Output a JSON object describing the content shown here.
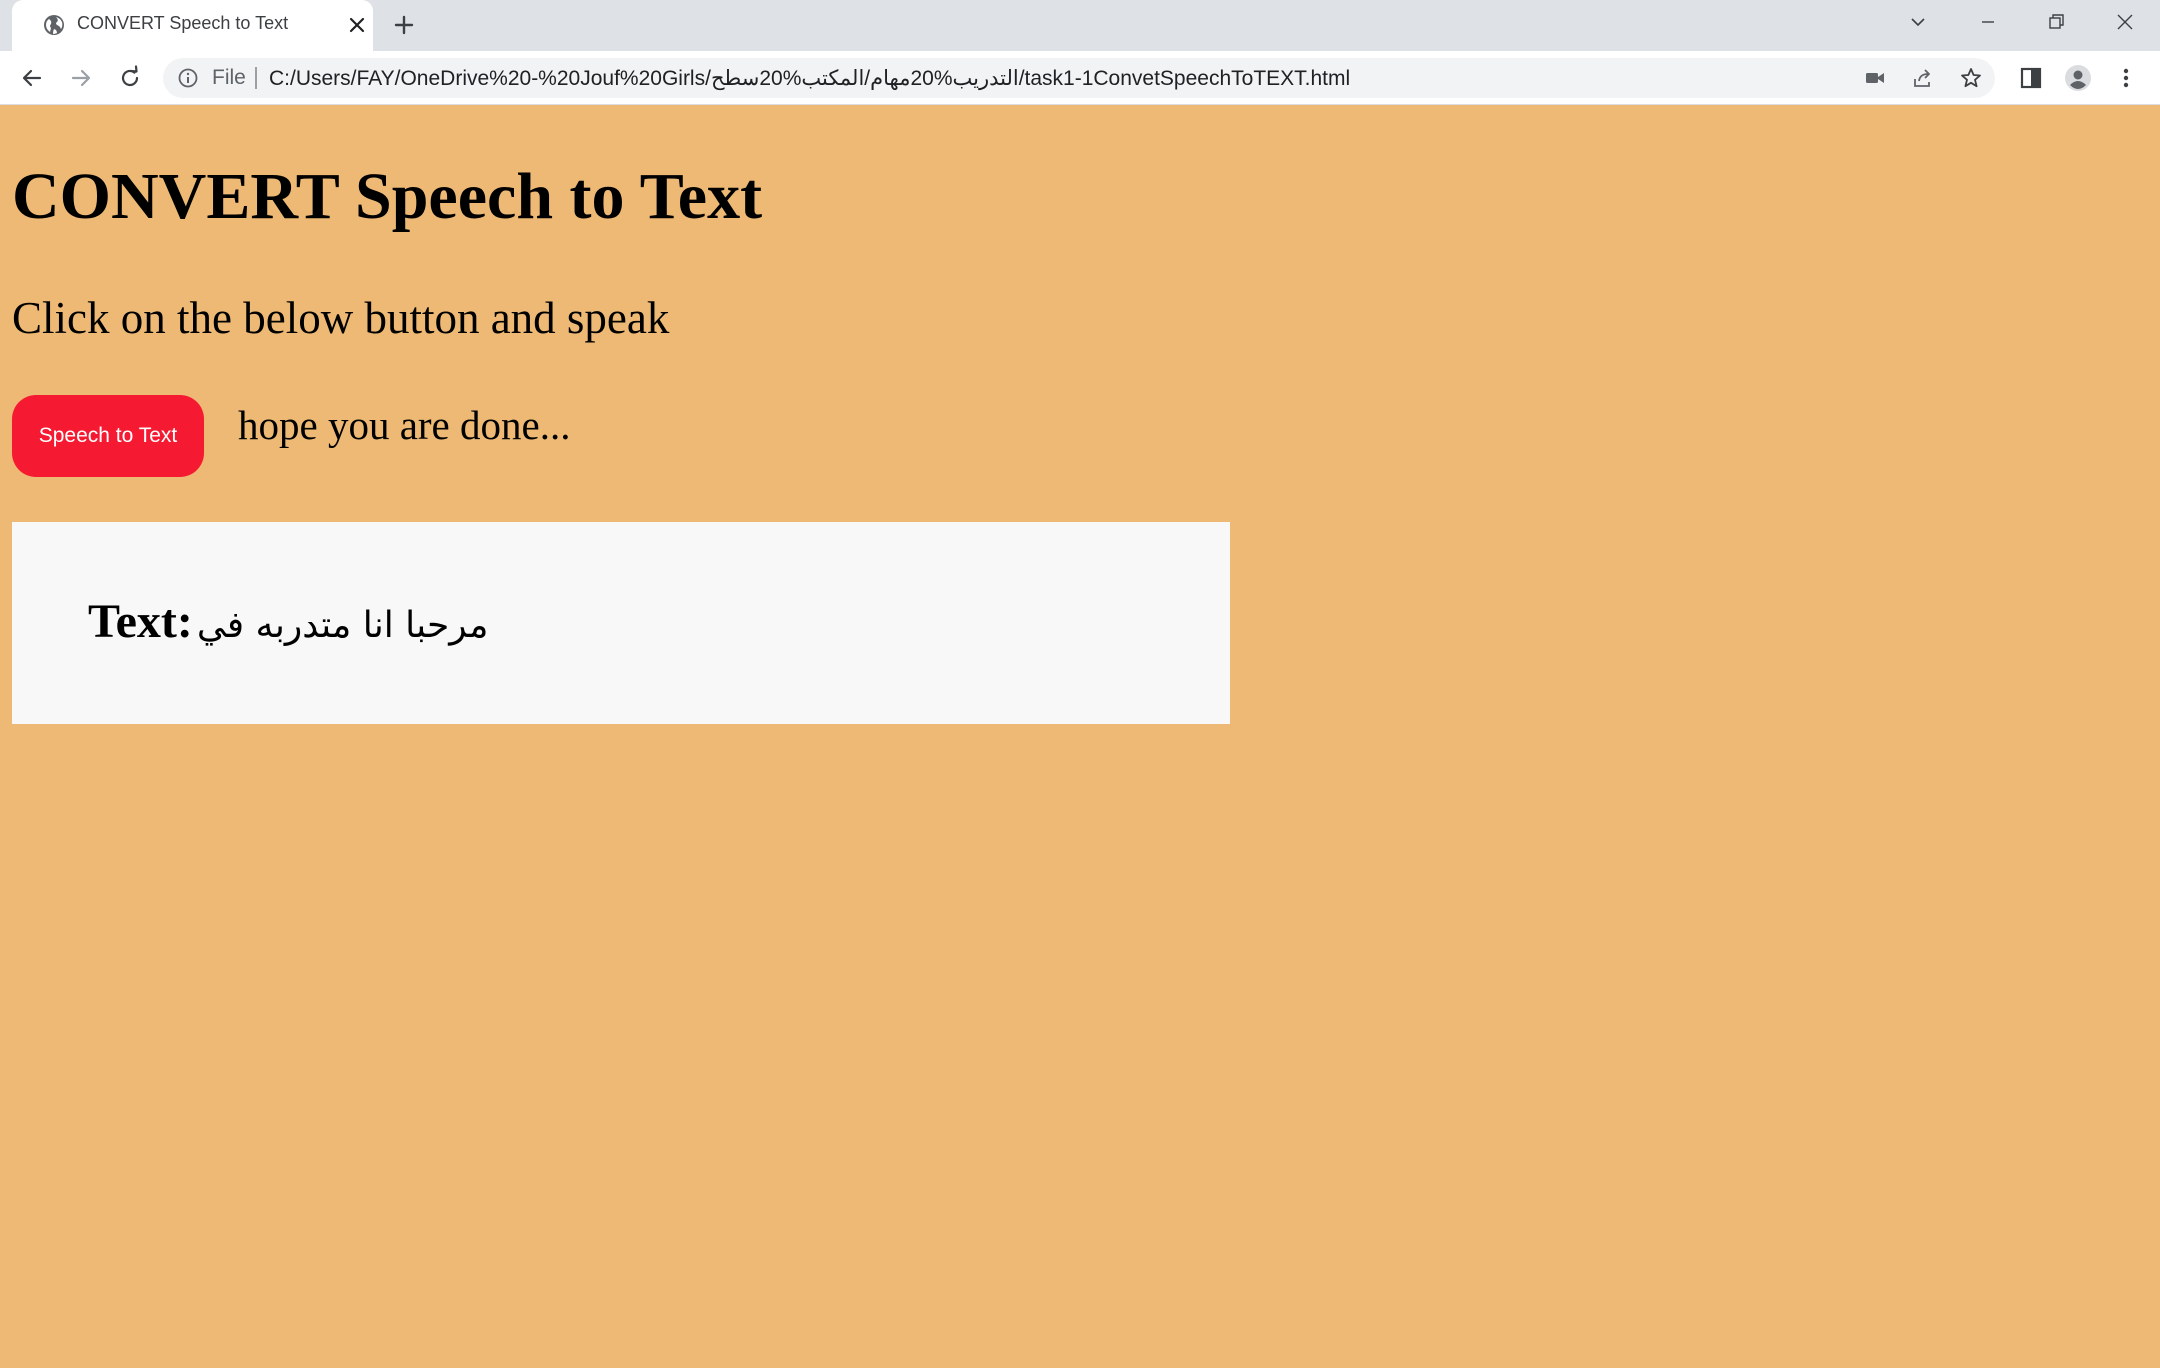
{
  "browser": {
    "tab_title": "CONVERT Speech to Text",
    "omnibox": {
      "scheme_label": "File",
      "url": "C:/Users/FAY/OneDrive%20-%20Jouf%20Girls/التدريب%20مهام/المكتب%20سطح/task1-1ConvetSpeechToTEXT.html"
    },
    "icons": {
      "favicon": "globe-icon",
      "tab_close": "close-icon",
      "new_tab": "plus-icon",
      "tab_search": "chevron-down-icon",
      "minimize": "minimize-icon",
      "restore": "restore-icon",
      "close_window": "close-icon",
      "back": "arrow-left-icon",
      "forward": "arrow-right-icon",
      "reload": "reload-icon",
      "site_info": "info-icon",
      "camera": "video-camera-icon",
      "share": "share-icon",
      "bookmark": "star-icon",
      "side_panel": "side-panel-icon",
      "profile": "profile-icon",
      "menu": "kebab-menu-icon"
    }
  },
  "page": {
    "background": "#edb974",
    "title": "CONVERT Speech to Text",
    "instruction": "Click on the below button and speak",
    "button_label": "Speech to Text",
    "button_color": "#f51a31",
    "status": "hope you are done...",
    "result": {
      "label": "Text:",
      "value": "مرحبا انا متدربه في"
    }
  }
}
